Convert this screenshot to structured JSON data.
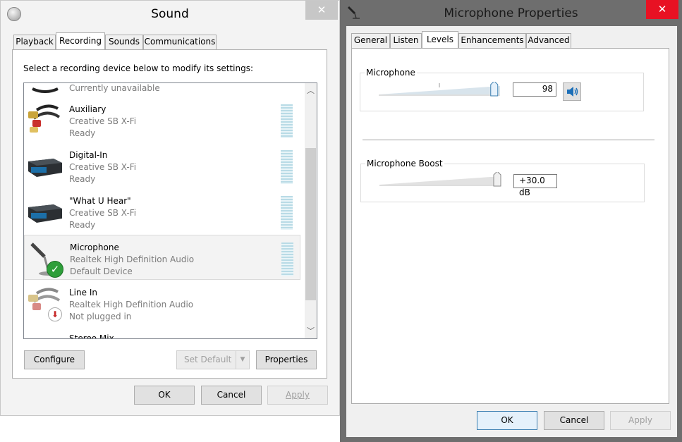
{
  "sound": {
    "title": "Sound",
    "close": "✕",
    "tabs": [
      "Playback",
      "Recording",
      "Sounds",
      "Communications"
    ],
    "instruction": "Select a recording device below to modify its settings:",
    "devices": [
      {
        "name": "",
        "line2": "",
        "line3": "Currently unavailable"
      },
      {
        "name": "Auxiliary",
        "line2": "Creative SB X-Fi",
        "line3": "Ready"
      },
      {
        "name": "Digital-In",
        "line2": "Creative SB X-Fi",
        "line3": "Ready"
      },
      {
        "name": "\"What U Hear\"",
        "line2": "Creative SB X-Fi",
        "line3": "Ready"
      },
      {
        "name": "Microphone",
        "line2": "Realtek High Definition Audio",
        "line3": "Default Device"
      },
      {
        "name": "Line In",
        "line2": "Realtek High Definition Audio",
        "line3": "Not plugged in"
      },
      {
        "name": "Stereo Mix",
        "line2": "",
        "line3": ""
      }
    ],
    "buttons": {
      "configure": "Configure",
      "set_default": "Set Default",
      "properties": "Properties",
      "ok": "OK",
      "cancel": "Cancel",
      "apply": "Apply"
    }
  },
  "mic": {
    "title": "Microphone Properties",
    "close": "✕",
    "tabs": [
      "General",
      "Listen",
      "Levels",
      "Enhancements",
      "Advanced"
    ],
    "microphone": {
      "label": "Microphone",
      "value": "98",
      "level": 0.98
    },
    "boost": {
      "label": "Microphone Boost",
      "value": "+30.0 dB",
      "level": 1.0
    },
    "buttons": {
      "ok": "OK",
      "cancel": "Cancel",
      "apply": "Apply"
    }
  },
  "colors": {
    "close_red": "#e81123",
    "mic_frame": "#6e6e6e",
    "accent_blue": "#3c7fb1"
  }
}
